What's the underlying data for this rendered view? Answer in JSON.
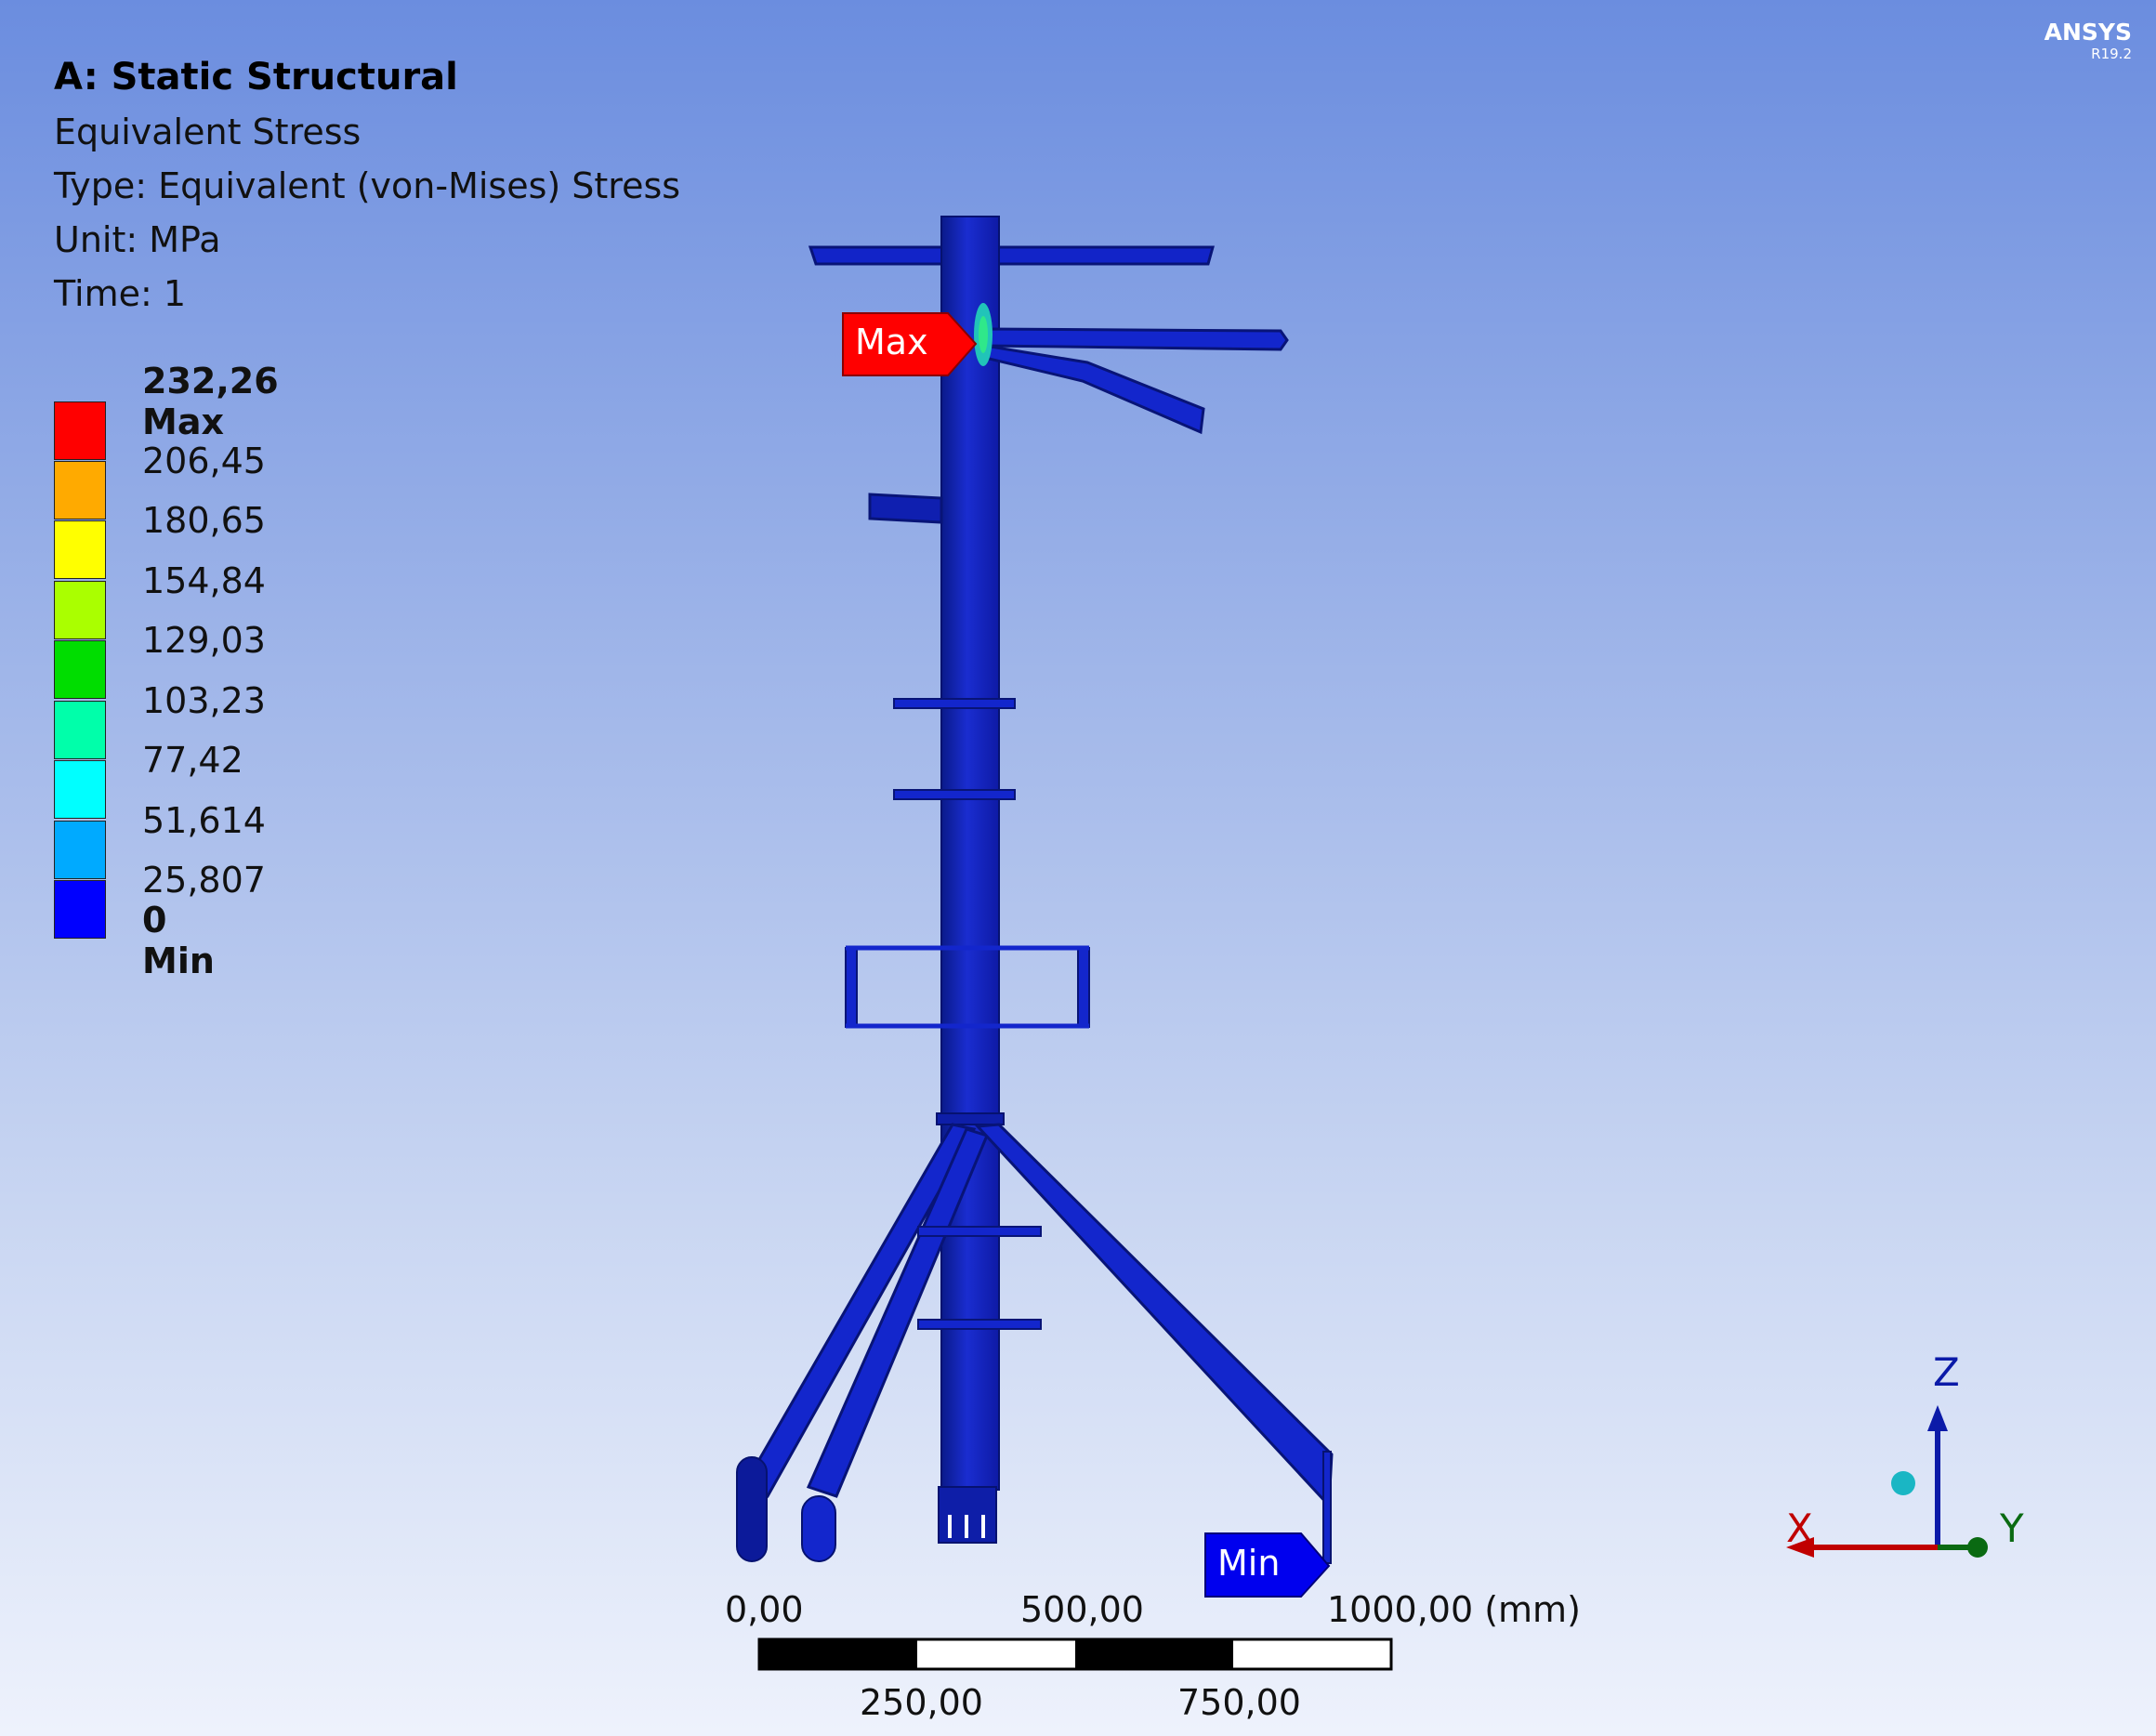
{
  "header": {
    "title": "A: Static Structural",
    "result": "Equivalent Stress",
    "type": "Type: Equivalent (von-Mises) Stress",
    "unit": "Unit: MPa",
    "time": "Time: 1"
  },
  "legend": {
    "levels": [
      {
        "label": "232,26 Max",
        "color": "#ff0000",
        "bold": true
      },
      {
        "label": "206,45",
        "color": "#ffaa00"
      },
      {
        "label": "180,65",
        "color": "#ffff00"
      },
      {
        "label": "154,84",
        "color": "#aaff00"
      },
      {
        "label": "129,03",
        "color": "#00dd00"
      },
      {
        "label": "103,23",
        "color": "#00ffaa"
      },
      {
        "label": "77,42",
        "color": "#00ffff"
      },
      {
        "label": "51,614",
        "color": "#00aaff"
      },
      {
        "label": "25,807",
        "color": "#0000ff"
      },
      {
        "label": "0 Min",
        "bold": true
      }
    ]
  },
  "brand": {
    "name": "ANSYS",
    "version": "R19.2"
  },
  "probes": {
    "max_label": "Max",
    "min_label": "Min",
    "max_color": "#ff0000",
    "min_color": "#0000ee"
  },
  "scale_bar": {
    "top_labels": [
      "0,00",
      "500,00",
      "1000,00 (mm)"
    ],
    "bottom_labels": [
      "250,00",
      "750,00"
    ]
  },
  "triad": {
    "x": "X",
    "y": "Y",
    "z": "Z"
  }
}
